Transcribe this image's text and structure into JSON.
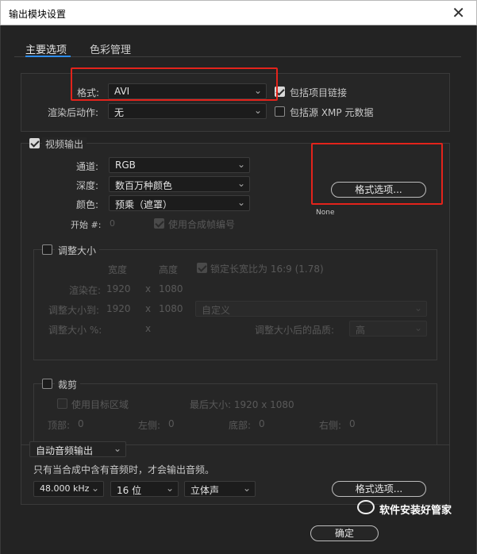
{
  "window": {
    "title": "输出模块设置",
    "close_glyph": "✕"
  },
  "tabs": [
    {
      "label": "主要选项"
    },
    {
      "label": "色彩管理"
    }
  ],
  "format_section": {
    "format_label": "格式:",
    "format_value": "AVI",
    "post_render_label": "渲染后动作:",
    "post_render_value": "无",
    "include_project_link": "包括项目链接",
    "include_xmp": "包括源 XMP 元数据"
  },
  "video_output": {
    "title": "视频输出",
    "channels_label": "通道:",
    "channels_value": "RGB",
    "depth_label": "深度:",
    "depth_value": "数百万种颜色",
    "color_label": "颜色:",
    "color_value": "预乘（遮罩）",
    "start_label": "开始 #:",
    "start_value": "0",
    "use_comp_frame": "使用合成帧编号",
    "format_options_button": "格式选项...",
    "codec_info": "None"
  },
  "resize": {
    "title": "调整大小",
    "width_header": "宽度",
    "height_header": "高度",
    "lock_aspect": "锁定长宽比为 16:9 (1.78)",
    "render_at_label": "渲染在:",
    "render_w": "1920",
    "render_h": "1080",
    "resize_to_label": "调整大小到:",
    "resize_w": "1920",
    "resize_h": "1080",
    "preset_value": "自定义",
    "percent_label": "调整大小 %:",
    "x_sep": "x",
    "quality_label": "调整大小后的品质:",
    "quality_value": "高"
  },
  "crop": {
    "title": "裁剪",
    "use_roi": "使用目标区域",
    "final_size": "最后大小: 1920 x 1080",
    "top_label": "顶部:",
    "top_value": "0",
    "left_label": "左侧:",
    "left_value": "0",
    "bottom_label": "底部:",
    "bottom_value": "0",
    "right_label": "右侧:",
    "right_value": "0"
  },
  "audio": {
    "mode_value": "自动音频输出",
    "note": "只有当合成中含有音频时，才会输出音频。",
    "rate_value": "48.000 kHz",
    "bits_value": "16 位",
    "channels_value": "立体声",
    "format_options_button": "格式选项..."
  },
  "footer": {
    "ok_button": "确定"
  },
  "watermark": {
    "text": "软件安装好管家"
  },
  "colors": {
    "accent": "#2d8ceb",
    "highlight_box": "#e3231b",
    "bg": "#232323"
  }
}
